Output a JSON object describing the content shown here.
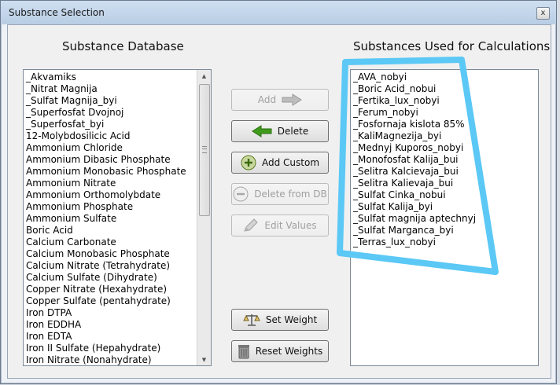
{
  "window": {
    "title": "Substance Selection",
    "close_glyph": "x"
  },
  "left_panel": {
    "heading": "Substance Database",
    "items": [
      "_Akvamiks",
      "_Nitrat Magnija",
      "_Sulfat Magnija_byi",
      "_Superfosfat Dvojnoj",
      "_Superfosfat_byi",
      "12-Molybdosilicic Acid",
      "Ammonium Chloride",
      "Ammonium Dibasic Phosphate",
      "Ammonium Monobasic Phosphate",
      "Ammonium Nitrate",
      "Ammonium Orthomolybdate",
      "Ammonium Phosphate",
      "Ammonium Sulfate",
      "Boric Acid",
      "Calcium Carbonate",
      "Calcium Monobasic Phosphate",
      "Calcium Nitrate (Tetrahydrate)",
      "Calcium Sulfate (Dihydrate)",
      "Copper Nitrate (Hexahydrate)",
      "Copper Sulfate (pentahydrate)",
      "Iron DTPA",
      "Iron EDDHA",
      "Iron EDTA",
      "Iron II Sulfate (Hepahydrate)",
      "Iron Nitrate (Nonahydrate)"
    ]
  },
  "right_panel": {
    "heading": "Substances Used for Calculations",
    "items": [
      "_AVA_nobyi",
      "_Boric Acid_nobui",
      "_Fertika_lux_nobyi",
      "_Ferum_nobyi",
      "_Fosfornaja kislota 85%",
      "_KaliMagnezija_byi",
      "_Mednyj Kuporos_nobyi",
      "_Monofosfat Kalija_bui",
      "_Selitra Kalcievaja_bui",
      "_Selitra Kalievaja_bui",
      "_Sulfat Cinka_nobui",
      "_Sulfat Kalija_byi",
      "_Sulfat magnija aptechnyj",
      "_Sulfat Marganca_byi",
      "_Terras_lux_nobyi"
    ]
  },
  "buttons": {
    "add": "Add",
    "delete": "Delete",
    "add_custom": "Add Custom",
    "delete_from_db": "Delete from DB",
    "edit_values": "Edit Values",
    "set_weight": "Set Weight",
    "reset_weights": "Reset Weights"
  },
  "icons": {
    "add": "right-arrow-icon",
    "delete": "left-arrow-icon",
    "add_custom": "plus-circle-icon",
    "delete_from_db": "minus-circle-icon",
    "edit_values": "pencil-icon",
    "set_weight": "scales-icon",
    "reset_weights": "trash-can-icon"
  },
  "colors": {
    "annotation_highlight": "#5bc8f5",
    "delete_arrow": "#3f9a1c"
  }
}
